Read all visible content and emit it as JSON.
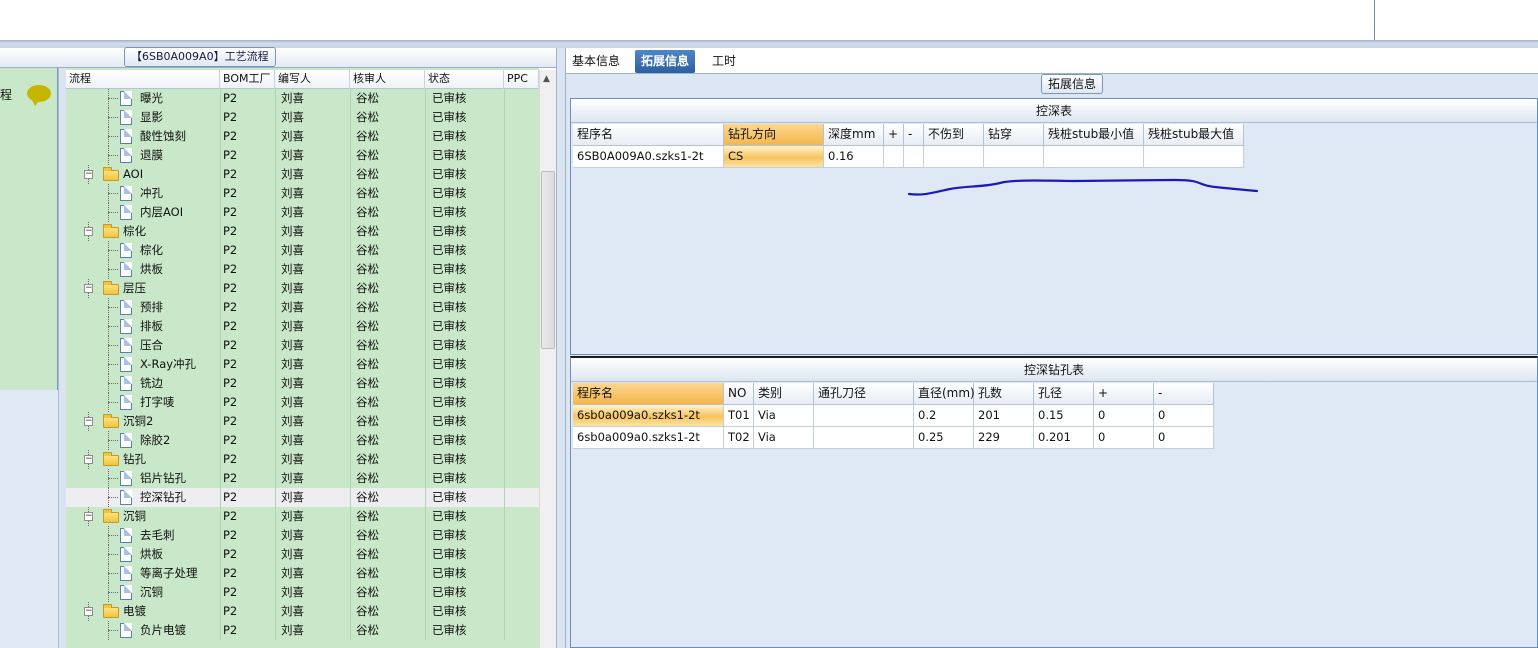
{
  "left": {
    "title": "【6SB0A009A0】工艺流程",
    "side_label": "程",
    "columns": [
      "流程",
      "BOM工厂",
      "编写人",
      "核审人",
      "状态",
      "PPC"
    ],
    "rows": [
      {
        "name": "曝光",
        "level": 2,
        "type": "doc",
        "bom": "P2",
        "author": "刘喜",
        "reviewer": "谷松",
        "status": "已审核"
      },
      {
        "name": "显影",
        "level": 2,
        "type": "doc",
        "bom": "P2",
        "author": "刘喜",
        "reviewer": "谷松",
        "status": "已审核"
      },
      {
        "name": "酸性蚀刻",
        "level": 2,
        "type": "doc",
        "bom": "P2",
        "author": "刘喜",
        "reviewer": "谷松",
        "status": "已审核"
      },
      {
        "name": "退膜",
        "level": 2,
        "type": "doc",
        "bom": "P2",
        "author": "刘喜",
        "reviewer": "谷松",
        "status": "已审核"
      },
      {
        "name": "AOI",
        "level": 1,
        "type": "folder",
        "bom": "P2",
        "author": "刘喜",
        "reviewer": "谷松",
        "status": "已审核"
      },
      {
        "name": "冲孔",
        "level": 2,
        "type": "doc",
        "bom": "P2",
        "author": "刘喜",
        "reviewer": "谷松",
        "status": "已审核"
      },
      {
        "name": "内层AOI",
        "level": 2,
        "type": "doc",
        "bom": "P2",
        "author": "刘喜",
        "reviewer": "谷松",
        "status": "已审核"
      },
      {
        "name": "棕化",
        "level": 1,
        "type": "folder",
        "bom": "P2",
        "author": "刘喜",
        "reviewer": "谷松",
        "status": "已审核"
      },
      {
        "name": "棕化",
        "level": 2,
        "type": "doc",
        "bom": "P2",
        "author": "刘喜",
        "reviewer": "谷松",
        "status": "已审核"
      },
      {
        "name": "烘板",
        "level": 2,
        "type": "doc",
        "bom": "P2",
        "author": "刘喜",
        "reviewer": "谷松",
        "status": "已审核"
      },
      {
        "name": "层压",
        "level": 1,
        "type": "folder",
        "bom": "P2",
        "author": "刘喜",
        "reviewer": "谷松",
        "status": "已审核"
      },
      {
        "name": "预排",
        "level": 2,
        "type": "doc",
        "bom": "P2",
        "author": "刘喜",
        "reviewer": "谷松",
        "status": "已审核"
      },
      {
        "name": "排板",
        "level": 2,
        "type": "doc",
        "bom": "P2",
        "author": "刘喜",
        "reviewer": "谷松",
        "status": "已审核"
      },
      {
        "name": "压合",
        "level": 2,
        "type": "doc",
        "bom": "P2",
        "author": "刘喜",
        "reviewer": "谷松",
        "status": "已审核"
      },
      {
        "name": "X-Ray冲孔",
        "level": 2,
        "type": "doc",
        "bom": "P2",
        "author": "刘喜",
        "reviewer": "谷松",
        "status": "已审核"
      },
      {
        "name": "铣边",
        "level": 2,
        "type": "doc",
        "bom": "P2",
        "author": "刘喜",
        "reviewer": "谷松",
        "status": "已审核"
      },
      {
        "name": "打字唛",
        "level": 2,
        "type": "doc",
        "bom": "P2",
        "author": "刘喜",
        "reviewer": "谷松",
        "status": "已审核"
      },
      {
        "name": "沉铜2",
        "level": 1,
        "type": "folder",
        "bom": "P2",
        "author": "刘喜",
        "reviewer": "谷松",
        "status": "已审核"
      },
      {
        "name": "除胶2",
        "level": 2,
        "type": "doc",
        "bom": "P2",
        "author": "刘喜",
        "reviewer": "谷松",
        "status": "已审核"
      },
      {
        "name": "钻孔",
        "level": 1,
        "type": "folder",
        "bom": "P2",
        "author": "刘喜",
        "reviewer": "谷松",
        "status": "已审核"
      },
      {
        "name": "铝片钻孔",
        "level": 2,
        "type": "doc",
        "bom": "P2",
        "author": "刘喜",
        "reviewer": "谷松",
        "status": "已审核"
      },
      {
        "name": "控深钻孔",
        "level": 2,
        "type": "doc",
        "bom": "P2",
        "author": "刘喜",
        "reviewer": "谷松",
        "status": "已审核",
        "selected": true
      },
      {
        "name": "沉铜",
        "level": 1,
        "type": "folder",
        "bom": "P2",
        "author": "刘喜",
        "reviewer": "谷松",
        "status": "已审核"
      },
      {
        "name": "去毛刺",
        "level": 2,
        "type": "doc",
        "bom": "P2",
        "author": "刘喜",
        "reviewer": "谷松",
        "status": "已审核"
      },
      {
        "name": "烘板",
        "level": 2,
        "type": "doc",
        "bom": "P2",
        "author": "刘喜",
        "reviewer": "谷松",
        "status": "已审核"
      },
      {
        "name": "等离子处理",
        "level": 2,
        "type": "doc",
        "bom": "P2",
        "author": "刘喜",
        "reviewer": "谷松",
        "status": "已审核"
      },
      {
        "name": "沉铜",
        "level": 2,
        "type": "doc",
        "bom": "P2",
        "author": "刘喜",
        "reviewer": "谷松",
        "status": "已审核"
      },
      {
        "name": "电镀",
        "level": 1,
        "type": "folder",
        "bom": "P2",
        "author": "刘喜",
        "reviewer": "谷松",
        "status": "已审核"
      },
      {
        "name": "负片电镀",
        "level": 2,
        "type": "doc",
        "bom": "P2",
        "author": "刘喜",
        "reviewer": "谷松",
        "status": "已审核"
      }
    ]
  },
  "right": {
    "tabs": [
      "基本信息",
      "拓展信息",
      "工时"
    ],
    "active_tab": 1,
    "section_title": "拓展信息",
    "table1": {
      "title": "控深表",
      "columns": [
        "程序名",
        "钻孔方向",
        "深度mm",
        "+",
        "-",
        "不伤到",
        "钻穿",
        "残桩stub最小值",
        "残桩stub最大值"
      ],
      "rows": [
        [
          "6SB0A009A0.szks1-2t",
          "CS",
          "0.16",
          "",
          "",
          "",
          "",
          "",
          ""
        ]
      ]
    },
    "table2": {
      "title": "控深钻孔表",
      "columns": [
        "程序名",
        "NO",
        "类别",
        "通孔刀径",
        "直径(mm)",
        "孔数",
        "孔径",
        "+",
        "-"
      ],
      "rows": [
        [
          "6sb0a009a0.szks1-2t",
          "T01",
          "Via",
          "",
          "0.2",
          "201",
          "0.15",
          "0",
          "0"
        ],
        [
          "6sb0a009a0.szks1-2t",
          "T02",
          "Via",
          "",
          "0.25",
          "229",
          "0.201",
          "0",
          "0"
        ]
      ]
    }
  },
  "colors": {
    "tree_bg": "#c9e8c9",
    "active_tab": "#2c5f9f",
    "highlight": "#f5b64c",
    "scribble": "#1a1ab8"
  }
}
